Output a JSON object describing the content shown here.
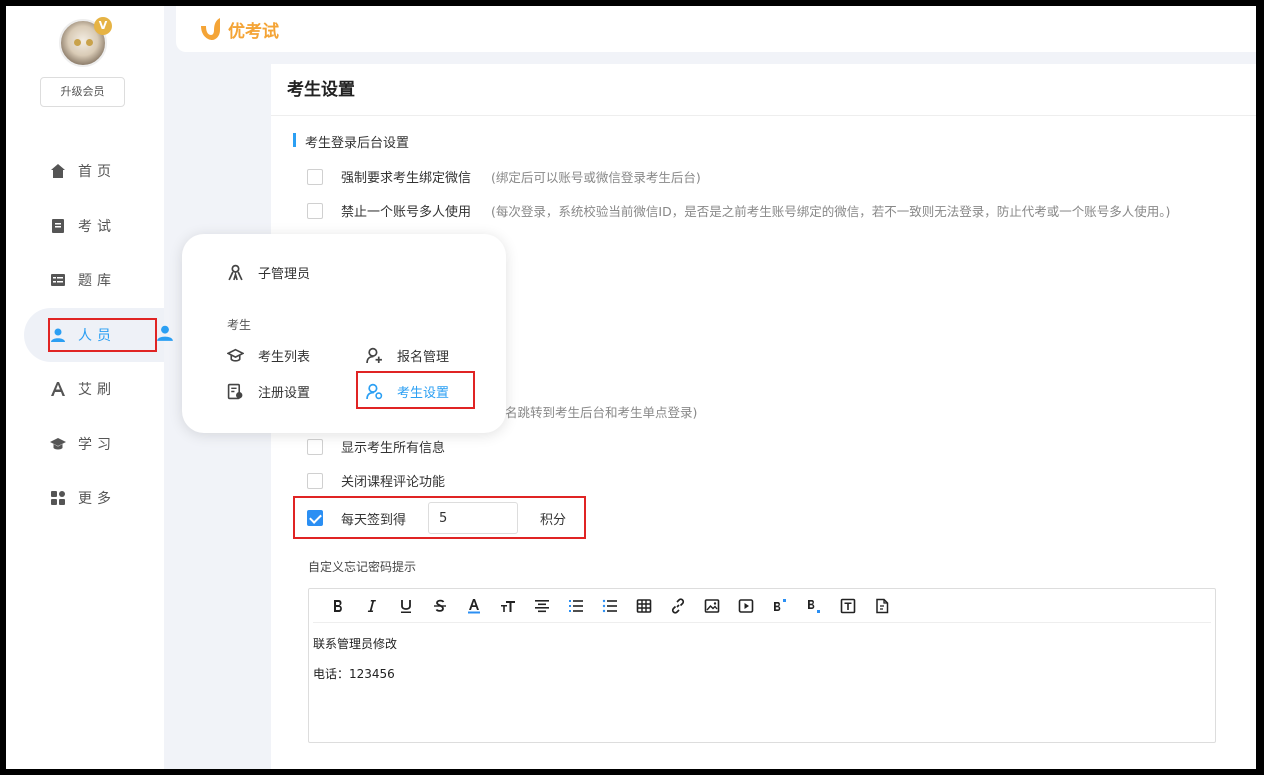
{
  "app": {
    "logo_text": "优考试",
    "brand_color": "#f4a436",
    "accent_color": "#2b9ff3"
  },
  "sidebar": {
    "vip_badge": "V",
    "upgrade_label": "升级会员",
    "items": [
      {
        "label": "首页",
        "icon": "home-icon"
      },
      {
        "label": "考试",
        "icon": "exam-icon"
      },
      {
        "label": "题库",
        "icon": "question-bank-icon"
      },
      {
        "label": "人员",
        "icon": "person-icon",
        "active": true
      },
      {
        "label": "艾刷",
        "icon": "letter-a-icon"
      },
      {
        "label": "学习",
        "icon": "graduation-cap-icon"
      },
      {
        "label": "更多",
        "icon": "grid-icon"
      }
    ]
  },
  "popup": {
    "sub_admin": "子管理员",
    "group_label": "考生",
    "student_list": "考生列表",
    "signup_manage": "报名管理",
    "register_settings": "注册设置",
    "student_settings": "考生设置"
  },
  "page": {
    "title": "考生设置",
    "section_login": "考生登录后台设置",
    "options": [
      {
        "label": "强制要求考生绑定微信",
        "hint": "(绑定后可以账号或微信登录考生后台)",
        "checked": false
      },
      {
        "label": "禁止一个账号多人使用",
        "hint": "(每次登录，系统校验当前微信ID，是否是之前考生账号绑定的微信，若不一致则无法登录，防止代考或一个账号多人使用。)",
        "checked": false
      }
    ],
    "partial_hint": "名跳转到考生后台和考生单点登录)",
    "show_all_info": "显示考生所有信息",
    "close_comment": "关闭课程评论功能",
    "daily_checkin_label": "每天签到得",
    "daily_checkin_value": "5",
    "daily_checkin_unit": "积分",
    "forgot_pwd_label": "自定义忘记密码提示",
    "editor_lines": [
      "联系管理员修改",
      "电话：123456"
    ]
  }
}
